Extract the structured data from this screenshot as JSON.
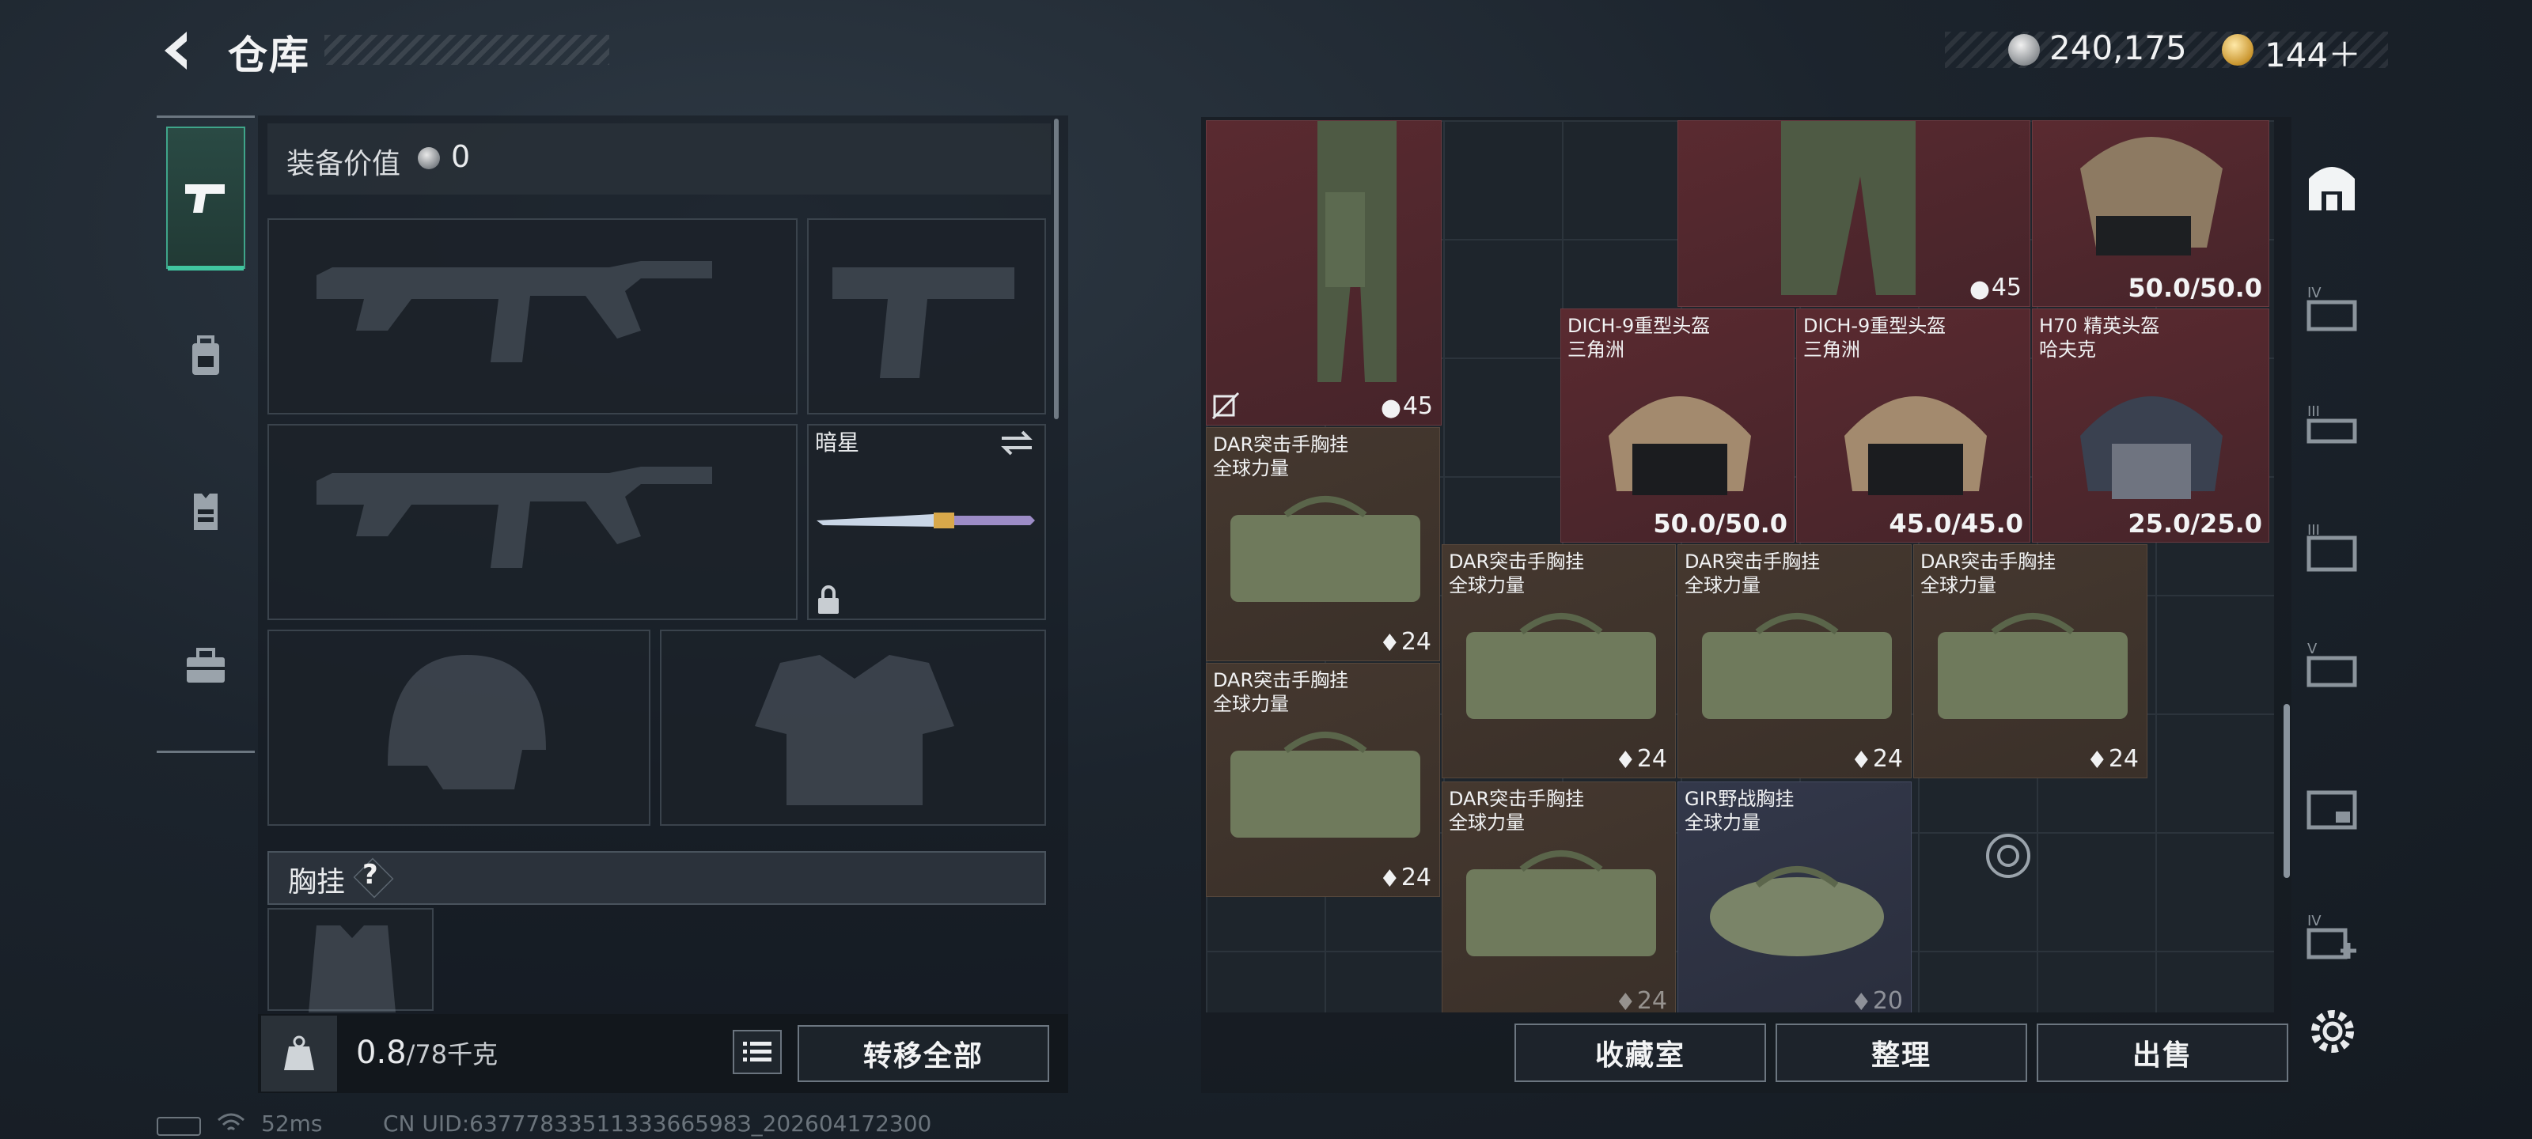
{
  "header": {
    "title": "仓库",
    "currency_silver": "240,175",
    "currency_gold": "144＋"
  },
  "sidebar_left": {
    "tabs": [
      {
        "name": "weapons",
        "icon": "pistol-icon",
        "active": true
      },
      {
        "name": "equipment",
        "icon": "backpack-icon",
        "active": false
      },
      {
        "name": "vest",
        "icon": "chest-rig-icon",
        "active": false
      },
      {
        "name": "kit",
        "icon": "toolbox-icon",
        "active": false
      }
    ]
  },
  "loadout": {
    "value_label": "装备价值",
    "value": "0",
    "knife_name": "暗星",
    "vest_label": "胸挂",
    "help": "?",
    "weight_value": "0.8",
    "weight_unit": "/78千克",
    "transfer_all": "转移全部"
  },
  "storage": {
    "items": [
      {
        "id": "pants-1",
        "name": [],
        "count": "45",
        "color": "red"
      },
      {
        "id": "pants-2",
        "name": [],
        "count": "45",
        "color": "red"
      },
      {
        "id": "helmet-top",
        "name": [],
        "durability": "50.0/50.0",
        "color": "red"
      },
      {
        "id": "helmet-dich-1",
        "name": [
          "DICH-9重型头盔",
          "三角洲"
        ],
        "durability": "50.0/50.0",
        "color": "red"
      },
      {
        "id": "helmet-dich-2",
        "name": [
          "DICH-9重型头盔",
          "三角洲"
        ],
        "durability": "45.0/45.0",
        "color": "red"
      },
      {
        "id": "helmet-h70",
        "name": [
          "H70 精英头盔",
          "哈夫克"
        ],
        "durability": "25.0/25.0",
        "color": "red"
      },
      {
        "id": "dar-1",
        "name": [
          "DAR突击手胸挂",
          "全球力量"
        ],
        "count": "24",
        "color": "brown"
      },
      {
        "id": "dar-2",
        "name": [
          "DAR突击手胸挂",
          "全球力量"
        ],
        "count": "24",
        "color": "brown"
      },
      {
        "id": "dar-3",
        "name": [
          "DAR突击手胸挂",
          "全球力量"
        ],
        "count": "24",
        "color": "brown"
      },
      {
        "id": "dar-4",
        "name": [
          "DAR突击手胸挂",
          "全球力量"
        ],
        "count": "24",
        "color": "brown"
      },
      {
        "id": "dar-5",
        "name": [
          "DAR突击手胸挂",
          "全球力量"
        ],
        "count": "24",
        "color": "brown"
      },
      {
        "id": "dar-6",
        "name": [
          "DAR突击手胸挂",
          "全球力量"
        ],
        "count": "24",
        "color": "brown"
      },
      {
        "id": "gir-1",
        "name": [
          "GIR野战胸挂",
          "全球力量"
        ],
        "count": "20",
        "color": "blue"
      }
    ],
    "buttons": {
      "collection": "收藏室",
      "sort": "整理",
      "sell": "出售"
    }
  },
  "sidebar_right": {
    "icons": [
      "safebox-icon",
      "case-iv-icon",
      "case-iii-icon",
      "case-iii-alt-icon",
      "case-v-icon",
      "case-extra-icon",
      "case-iv-add-icon",
      "settings-gear-icon"
    ]
  },
  "status": {
    "ping": "52ms",
    "uid": "CN UID:6377783351133366598З_202604172300"
  },
  "colors": {
    "accent": "#41c6a0",
    "item_red": "#5a2a30",
    "item_brown": "#45382f",
    "item_blue": "#33384a"
  }
}
